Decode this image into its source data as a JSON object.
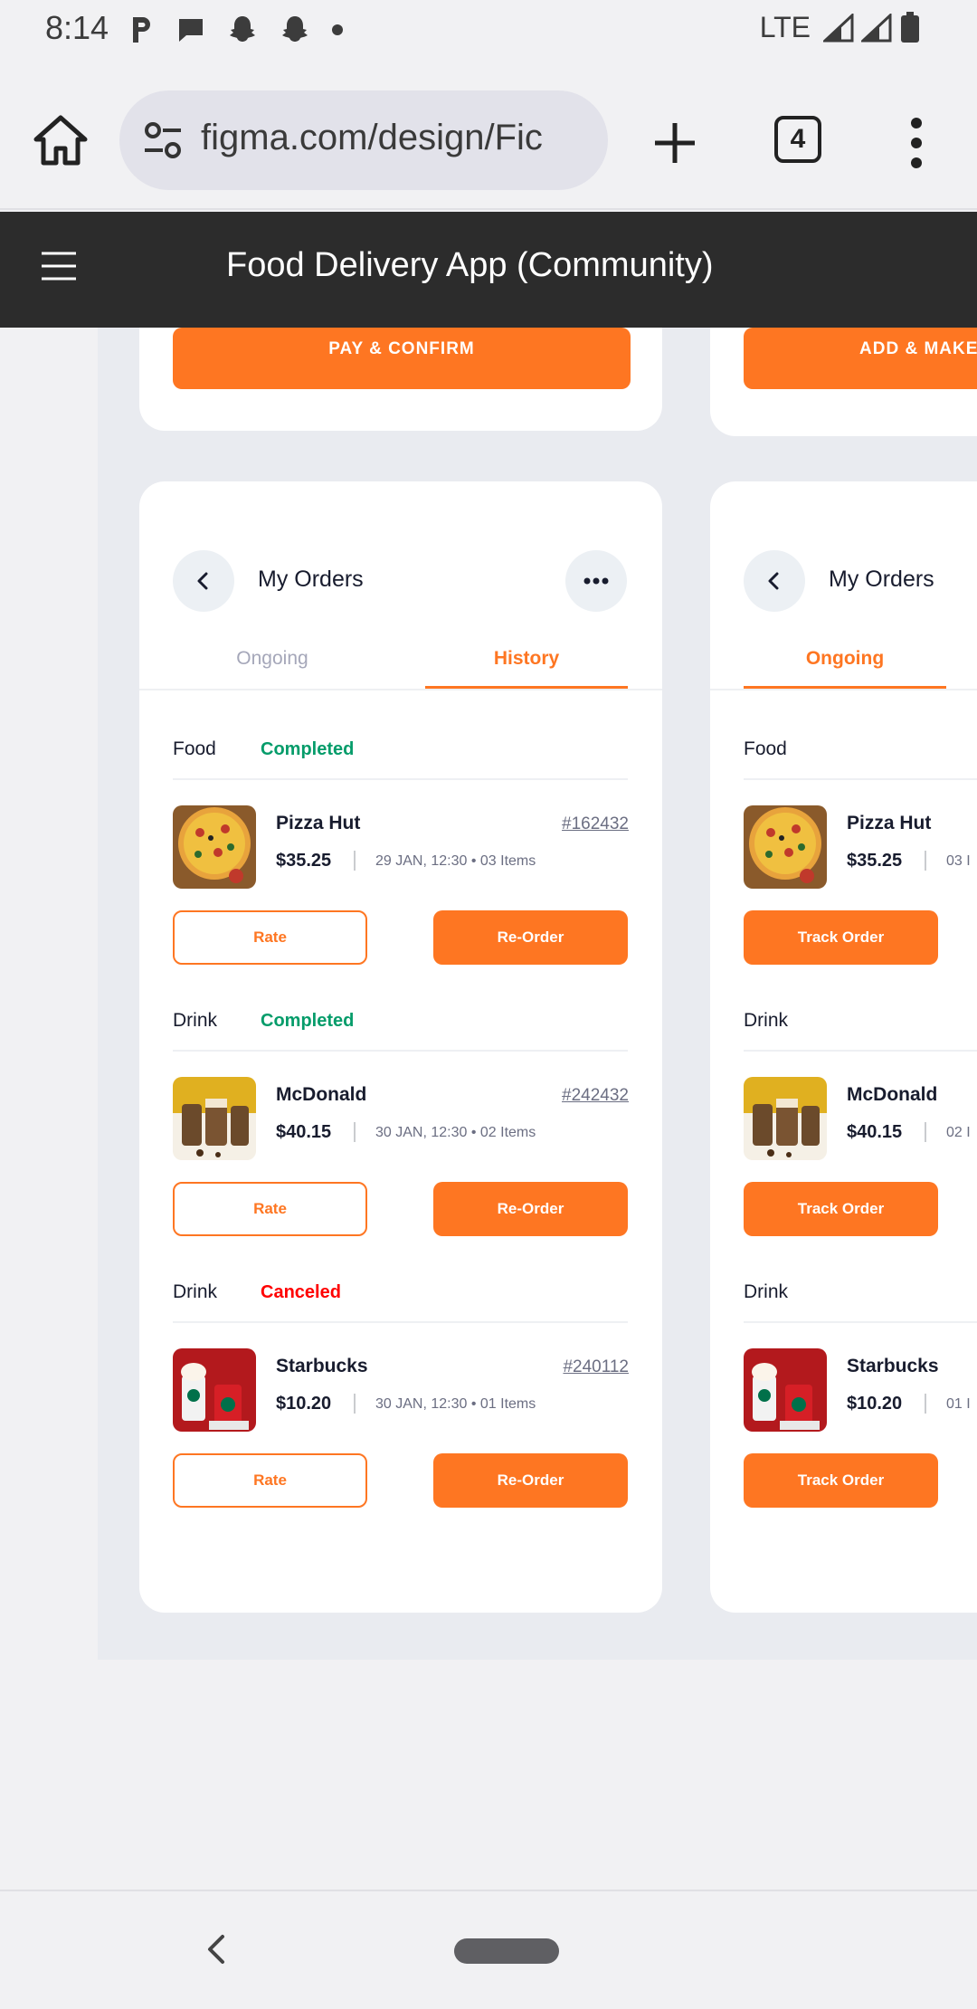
{
  "status_bar": {
    "time": "8:14",
    "network": "LTE"
  },
  "browser": {
    "url": "figma.com/design/Fic",
    "tab_count": "4"
  },
  "figma": {
    "title": "Food Delivery App (Community)"
  },
  "top_cards": {
    "left_button": "PAY & CONFIRM",
    "right_button": "ADD & MAKE"
  },
  "orders_left": {
    "title": "My Orders",
    "tabs": [
      "Ongoing",
      "History"
    ],
    "active_tab": "History",
    "orders": [
      {
        "category": "Food",
        "status": "Completed",
        "status_color": "#059c6a",
        "restaurant": "Pizza Hut",
        "order_no": "#162432",
        "price": "$35.25",
        "meta": "29 JAN, 12:30  •  03 Items",
        "btn_rate": "Rate",
        "btn_reorder": "Re-Order",
        "image": "pizza"
      },
      {
        "category": "Drink",
        "status": "Completed",
        "status_color": "#059c6a",
        "restaurant": "McDonald",
        "order_no": "#242432",
        "price": "$40.15",
        "meta": "30 JAN, 12:30  •  02 Items",
        "btn_rate": "Rate",
        "btn_reorder": "Re-Order",
        "image": "coffee"
      },
      {
        "category": "Drink",
        "status": "Canceled",
        "status_color": "#ff0000",
        "restaurant": "Starbucks",
        "order_no": "#240112",
        "price": "$10.20",
        "meta": "30 JAN, 12:30  •  01 Items",
        "btn_rate": "Rate",
        "btn_reorder": "Re-Order",
        "image": "starbucks"
      }
    ]
  },
  "orders_right": {
    "title": "My Orders",
    "active_tab": "Ongoing",
    "orders": [
      {
        "category": "Food",
        "restaurant": "Pizza Hut",
        "price": "$35.25",
        "meta": "03 I",
        "btn": "Track Order",
        "image": "pizza"
      },
      {
        "category": "Drink",
        "restaurant": "McDonald",
        "price": "$40.15",
        "meta": "02 I",
        "btn": "Track Order",
        "image": "coffee"
      },
      {
        "category": "Drink",
        "restaurant": "Starbucks",
        "price": "$10.20",
        "meta": "01 I",
        "btn": "Track Order",
        "image": "starbucks"
      }
    ]
  },
  "colors": {
    "accent": "#fe7622",
    "completed": "#059c6a",
    "canceled": "#ff0000",
    "header": "#2c2c2c"
  },
  "icons": [
    "home-icon",
    "site-settings-icon",
    "new-tab-icon",
    "tab-switcher-icon",
    "overflow-menu-icon",
    "hamburger-icon",
    "back-arrow-icon",
    "more-dots-icon",
    "nav-back-icon",
    "nav-home-pill"
  ]
}
